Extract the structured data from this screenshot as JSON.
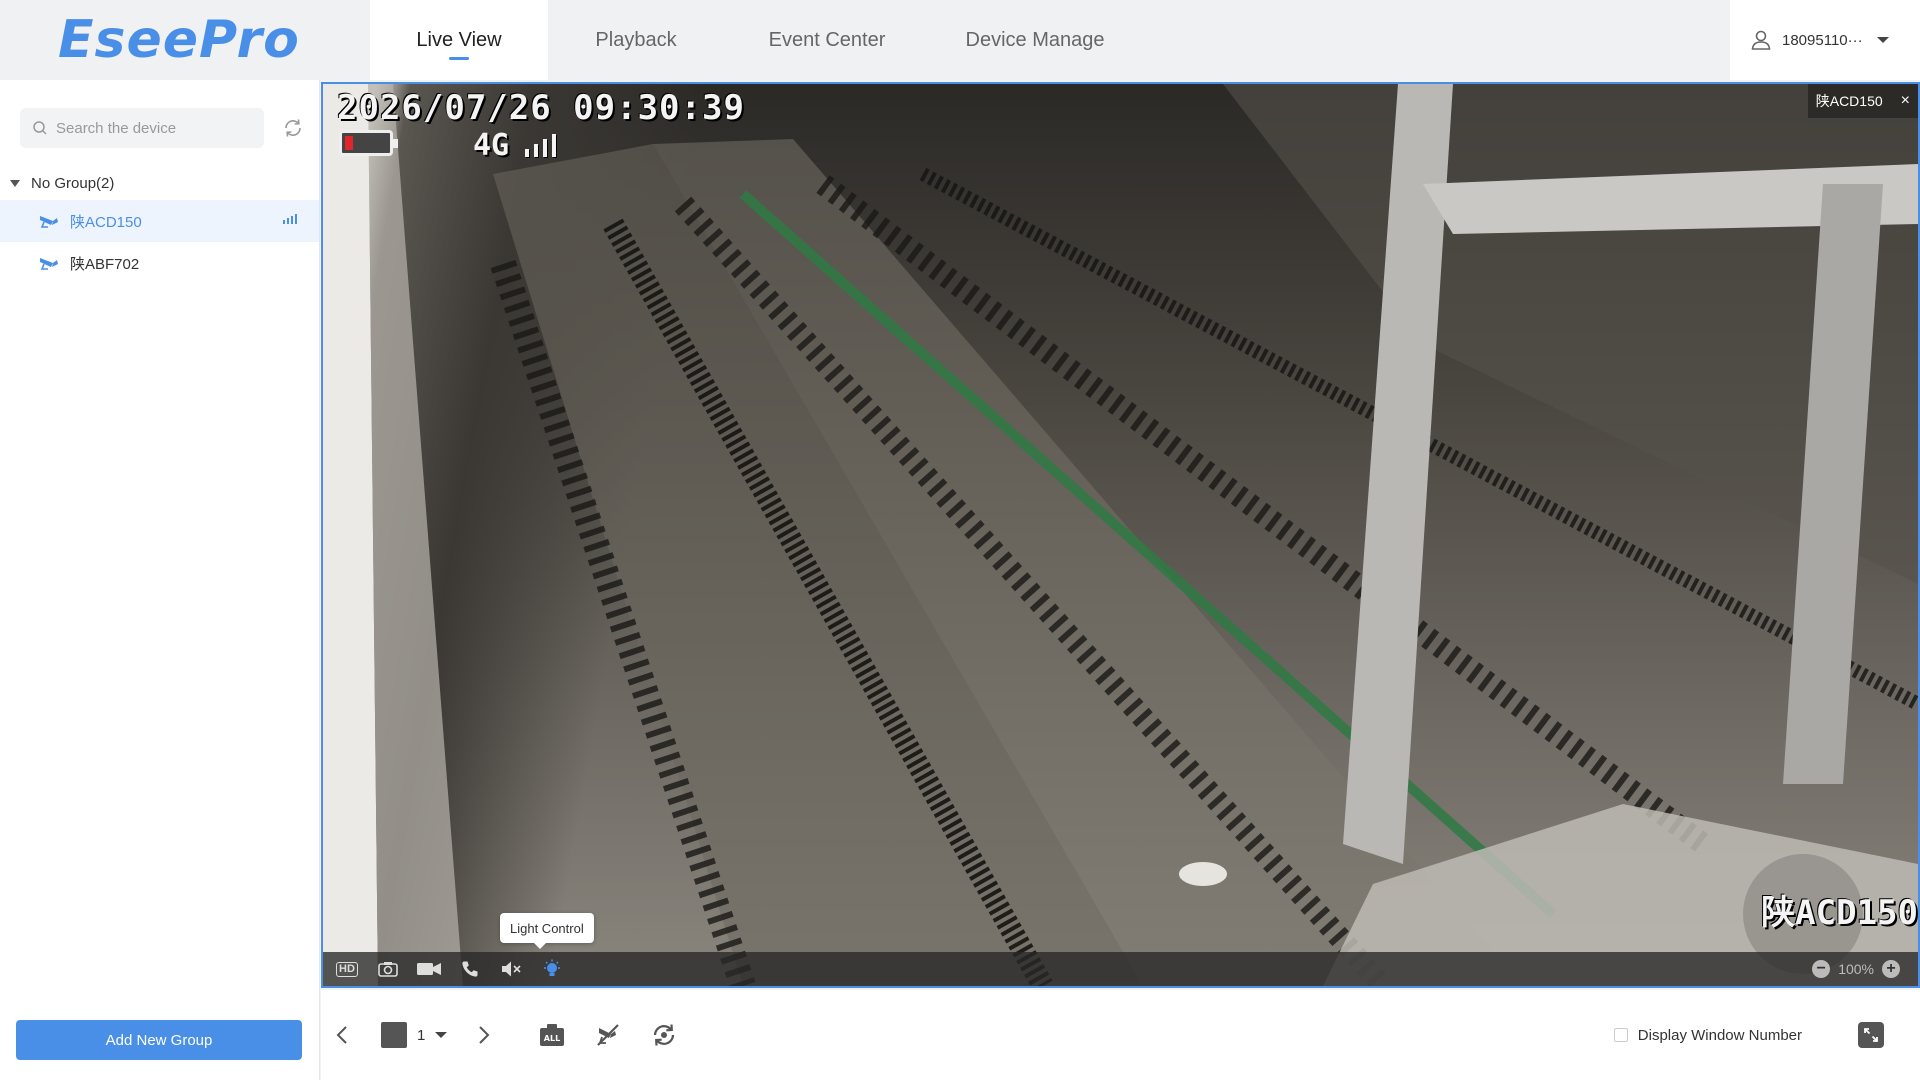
{
  "header": {
    "logo": "EseePro",
    "tabs": [
      {
        "label": "Live View",
        "active": true
      },
      {
        "label": "Playback",
        "active": false
      },
      {
        "label": "Event Center",
        "active": false
      },
      {
        "label": "Device Manage",
        "active": false
      }
    ],
    "user": {
      "name": "18095110···",
      "icon": "user-icon"
    }
  },
  "sidebar": {
    "search": {
      "placeholder": "Search the device",
      "value": ""
    },
    "group": {
      "label": "No Group(2)",
      "expanded": true
    },
    "devices": [
      {
        "name": "陕ACD150",
        "selected": true,
        "status_icon": "signal-icon"
      },
      {
        "name": "陕ABF702",
        "selected": false
      }
    ],
    "add_group_label": "Add New Group"
  },
  "video": {
    "window_title": "陕ACD150",
    "close_label": "×",
    "osd": {
      "datetime": "2026/07/26 09:30:39",
      "network": "4G",
      "device_name": "陕ACD150",
      "signal_bars": 4
    },
    "toolbar": {
      "hd_label": "HD",
      "tooltip": "Light Control",
      "zoom_level": "100%",
      "zoom_out": "−",
      "zoom_in": "+"
    }
  },
  "bottombar": {
    "page_number": "1",
    "display_window_number_label": "Display Window Number",
    "all_label": "ALL"
  },
  "colors": {
    "accent": "#4a8fe7",
    "battery_low": "#e0262b"
  }
}
